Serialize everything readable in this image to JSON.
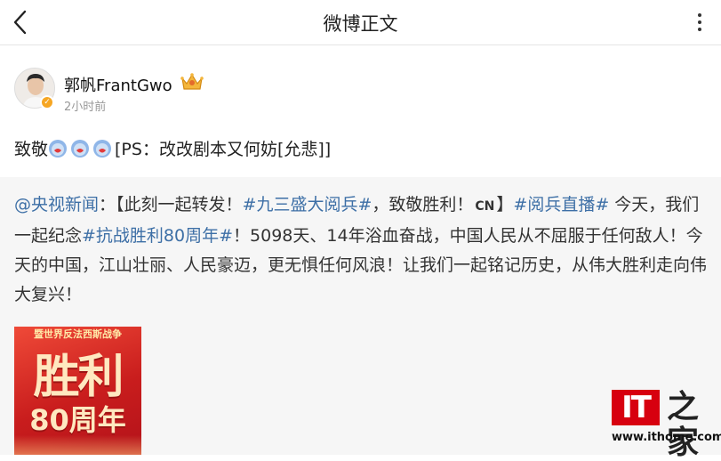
{
  "nav": {
    "title": "微博正文",
    "back_icon": "chevron-left-icon",
    "more_icon": "more-vertical-icon"
  },
  "author": {
    "name": "郭帆FrantGwo",
    "time": "2小时前",
    "badge_icon": "verified-badge-icon",
    "badge_color": "#f6a623",
    "crown_icon": "crown-icon"
  },
  "post": {
    "text_prefix": "致敬",
    "emoji_icon": "salute-emoji-icon",
    "emoji_count": 3,
    "text_suffix": "[PS：改改剧本又何妨[允悲]]"
  },
  "repost": {
    "mention": "@央视新闻",
    "t1": "：【此刻一起转发！",
    "tag1": "#九三盛大阅兵#",
    "t2": "，致敬胜利！",
    "cn": "CN",
    "t3": "】",
    "tag2": "#阅兵直播#",
    "t4": " 今天，我们一起纪念",
    "tag3": "#抗战胜利80周年#",
    "t5": "！5098天、14年浴血奋战，中国人民从不屈服于任何敌人！今天的中国，江山壮丽、人民豪迈，更无惧任何风浪！让我们一起铭记历史，从伟大胜利走向伟大复兴！",
    "link_color": "#3d6fa6"
  },
  "poster": {
    "top": "暨世界反法西斯战争",
    "big": "胜利",
    "year": "80周年"
  },
  "watermark": {
    "logo": "IT",
    "zhi": "之家",
    "url": "www.ithome.com",
    "brand_color": "#d7000f"
  }
}
